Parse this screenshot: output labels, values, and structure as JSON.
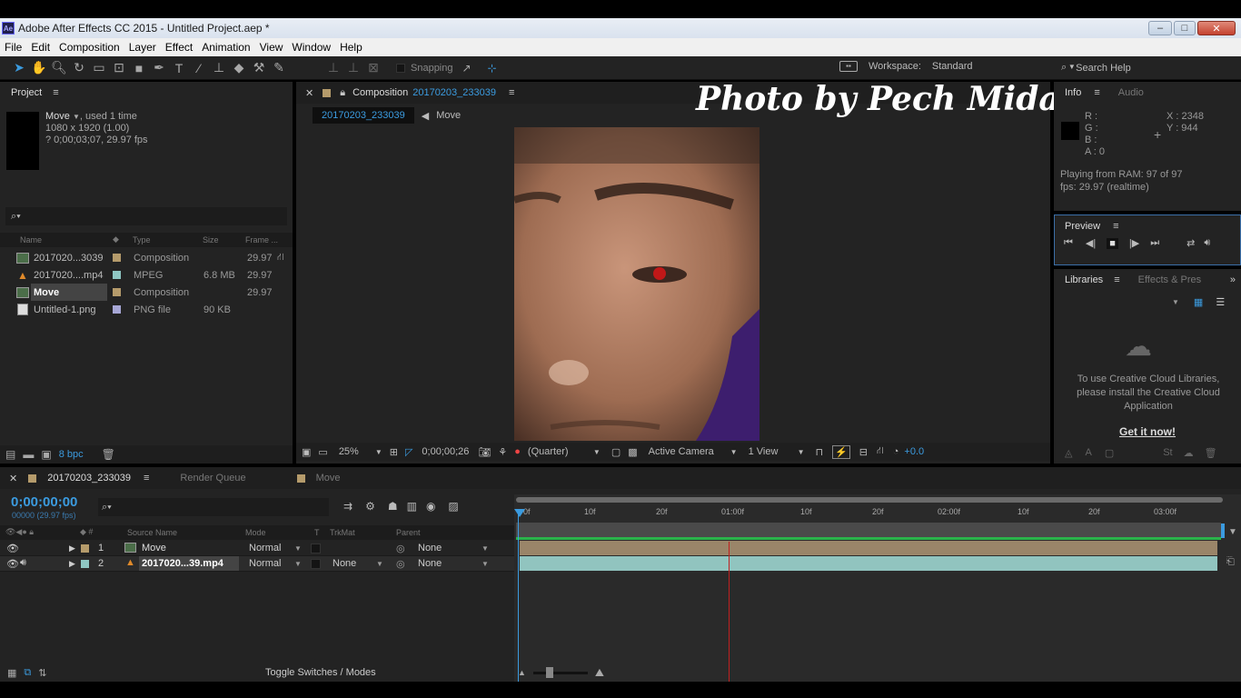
{
  "window": {
    "title": "Adobe After Effects CC 2015 - Untitled Project.aep *",
    "app_badge": "Ae",
    "controls": [
      "–",
      "□",
      "✕"
    ]
  },
  "menu": [
    "File",
    "Edit",
    "Composition",
    "Layer",
    "Effect",
    "Animation",
    "View",
    "Window",
    "Help"
  ],
  "toolbar": {
    "snapping_label": "Snapping",
    "workspace_label": "Workspace:",
    "workspace_value": "Standard",
    "search_help": "Search Help"
  },
  "project": {
    "title": "Project",
    "item_name": "Move",
    "item_used": ", used 1 time",
    "item_dims": "1080 x 1920 (1.00)",
    "item_duration": "? 0;00;03;07, 29.97 fps",
    "columns": [
      "Name",
      "Type",
      "Size",
      "Frame ..."
    ],
    "rows": [
      {
        "name": "2017020...3039",
        "type": "Composition",
        "size": "",
        "fps": "29.97",
        "color": "#b59b6b"
      },
      {
        "name": "2017020....mp4",
        "type": "MPEG",
        "size": "6.8 MB",
        "fps": "29.97",
        "color": "#8fc7c3"
      },
      {
        "name": "Move",
        "type": "Composition",
        "size": "",
        "fps": "29.97",
        "color": "#b59b6b"
      },
      {
        "name": "Untitled-1.png",
        "type": "PNG file",
        "size": "90 KB",
        "fps": "",
        "color": "#a7a7d6"
      }
    ],
    "bpc": "8 bpc"
  },
  "composition": {
    "tab_label": "Composition",
    "tab_name": "20170203_233039",
    "crumb_active": "20170203_233039",
    "crumb_next": "Move",
    "zoom": "25%",
    "timecode": "0;00;00;26",
    "resolution": "(Quarter)",
    "camera": "Active Camera",
    "views": "1 View",
    "exposure": "+0.0"
  },
  "watermark": "Photo by Pech Midas",
  "info": {
    "title": "Info",
    "tab2": "Audio",
    "r": "R :",
    "g": "G :",
    "b": "B :",
    "a": "A : 0",
    "x": "X : 2348",
    "y": "Y : 944",
    "playing": "Playing from RAM: 97 of 97",
    "fps": "fps: 29.97 (realtime)"
  },
  "preview": {
    "title": "Preview"
  },
  "libraries": {
    "title": "Libraries",
    "tab2": "Effects & Pres",
    "message": "To use Creative Cloud Libraries, please install the Creative Cloud Application",
    "link": "Get it now!"
  },
  "timeline": {
    "tabs": [
      "20170203_233039",
      "Render Queue",
      "Move"
    ],
    "timecode": "0;00;00;00",
    "fps_note": "00000 (29.97 fps)",
    "columns": [
      "Source Name",
      "Mode",
      "T",
      "TrkMat",
      "Parent"
    ],
    "ruler": [
      "0f",
      "10f",
      "20f",
      "01:00f",
      "10f",
      "20f",
      "02:00f",
      "10f",
      "20f",
      "03:00f"
    ],
    "layers": [
      {
        "num": "1",
        "name": "Move",
        "mode": "Normal",
        "trkmat": "",
        "parent": "None",
        "color": "#b59b6b"
      },
      {
        "num": "2",
        "name": "2017020...39.mp4",
        "mode": "Normal",
        "trkmat": "None",
        "parent": "None",
        "color": "#8fc7c3"
      }
    ],
    "toggle_label": "Toggle Switches / Modes"
  }
}
